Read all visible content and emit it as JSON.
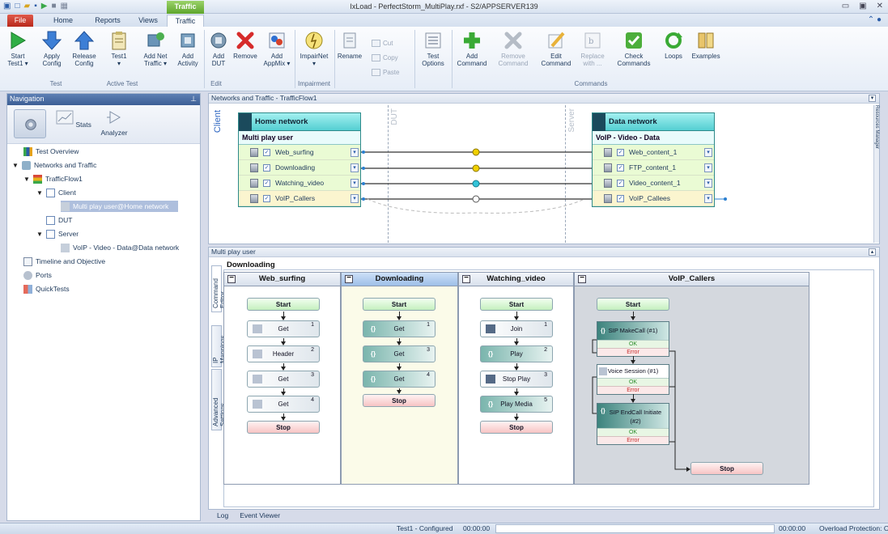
{
  "window": {
    "title": "IxLoad - PerfectStorm_MultiPlay.rxf - S2/APPSERVER139",
    "context_tab": "Traffic"
  },
  "menu": {
    "tabs": [
      "File",
      "Home",
      "Reports",
      "Views",
      "Traffic"
    ],
    "active": "Traffic"
  },
  "ribbon": {
    "groups": {
      "test": "Test",
      "active_test": "Active Test",
      "edit": "Edit",
      "impairment": "Impairment",
      "commands": "Commands"
    },
    "buttons": {
      "start": "Start\nTest1 ▾",
      "apply": "Apply\nConfig",
      "release": "Release\nConfig",
      "test1": "Test1\n▾",
      "add_net": "Add Net\nTraffic ▾",
      "add_activity": "Add\nActivity",
      "add_dut": "Add\nDUT",
      "remove": "Remove",
      "add_appmix": "Add\nAppMix ▾",
      "impairnet": "ImpairNet\n▾",
      "rename": "Rename",
      "cut": "Cut",
      "copy": "Copy",
      "paste": "Paste",
      "test_options": "Test\nOptions",
      "add_command": "Add\nCommand",
      "remove_command": "Remove\nCommand",
      "edit_command": "Edit\nCommand",
      "replace_with": "Replace\nwith ...",
      "check_commands": "Check\nCommands",
      "loops": "Loops",
      "examples": "Examples"
    }
  },
  "navigation": {
    "title": "Navigation",
    "tools": [
      "Stats",
      "Analyzer"
    ],
    "tree": {
      "test_overview": "Test Overview",
      "networks_and_traffic": "Networks and Traffic",
      "trafficflow1": "TrafficFlow1",
      "client": "Client",
      "client_item": "Multi play user@Home network",
      "dut": "DUT",
      "server": "Server",
      "server_item": "VoIP - Video - Data@Data network",
      "timeline": "Timeline and Objective",
      "ports": "Ports",
      "quicktests": "QuickTests"
    }
  },
  "networks_panel": {
    "title": "Networks and Traffic - TrafficFlow1",
    "client_label": "Client",
    "dut_label": "DUT",
    "server_label": "Server",
    "right_tab": "Resources Manager",
    "client_net": {
      "name": "Home network",
      "user": "Multi play user",
      "activities": [
        "Web_surfing",
        "Downloading",
        "Watching_video",
        "VoIP_Callers"
      ]
    },
    "server_net": {
      "name": "Data network",
      "user": "VoIP - Video - Data",
      "activities": [
        "Web_content_1",
        "FTP_content_1",
        "Video_content_1",
        "VoIP_Callees"
      ]
    }
  },
  "command_panel": {
    "title": "Multi play user",
    "selected_activity": "Downloading",
    "side_tabs": [
      "Command Editor",
      "IP Mappings",
      "Advanced Settings"
    ],
    "columns": [
      {
        "name": "Web_surfing",
        "start": "Start",
        "stop": "Stop",
        "steps": [
          {
            "label": "Get",
            "num": "1"
          },
          {
            "label": "Header",
            "num": "2"
          },
          {
            "label": "Get",
            "num": "3"
          },
          {
            "label": "Get",
            "num": "4"
          }
        ]
      },
      {
        "name": "Downloading",
        "start": "Start",
        "stop": "Stop",
        "steps": [
          {
            "label": "Get",
            "num": "1"
          },
          {
            "label": "Get",
            "num": "3"
          },
          {
            "label": "Get",
            "num": "4"
          }
        ]
      },
      {
        "name": "Watching_video",
        "start": "Start",
        "stop": "Stop",
        "steps": [
          {
            "label": "Join",
            "num": "1"
          },
          {
            "label": "Play",
            "num": "2"
          },
          {
            "label": "Stop Play",
            "num": "3"
          },
          {
            "label": "Play Media",
            "num": "5"
          }
        ]
      },
      {
        "name": "VoIP_Callers",
        "start": "Start",
        "stop": "Stop",
        "steps": [
          {
            "label": "SIP MakeCall (#1)",
            "ok": "OK",
            "err": "Error"
          },
          {
            "label": "Voice Session (#1)",
            "ok": "OK",
            "err": "Error"
          },
          {
            "label": "SIP EndCall Initiate (#2)",
            "ok": "OK",
            "err": "Error"
          }
        ]
      }
    ]
  },
  "bottom_tabs": [
    "Log",
    "Event Viewer"
  ],
  "status": {
    "state": "Test1 - Configured",
    "elapsed": "00:00:00",
    "remaining": "00:00:00",
    "overload": "Overload Protection: O"
  },
  "colors": {
    "accent": "#2a5ca8",
    "net_header": "#54cfd2",
    "link_yellow": "#f0d000",
    "link_cyan": "#33c4d9"
  }
}
